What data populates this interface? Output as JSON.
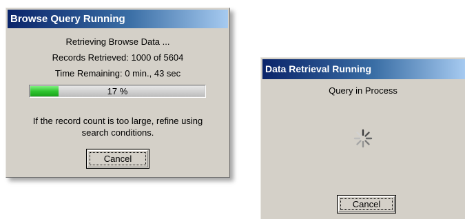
{
  "browse_dialog": {
    "title": "Browse Query Running",
    "status_line": "Retrieving Browse Data ...",
    "records_line": "Records Retrieved:  1000  of  5604",
    "time_line": "Time Remaining:  0 min., 43 sec",
    "progress": {
      "percent": 17,
      "label": "17 %"
    },
    "hint_line1": "If the record count is too large, refine using",
    "hint_line2": "search conditions.",
    "cancel_label": "Cancel"
  },
  "retrieval_dialog": {
    "title": "Data Retrieval Running",
    "status_line": "Query in Process",
    "spinner_icon": "busy-spinner-icon",
    "cancel_label": "Cancel"
  },
  "colors": {
    "title_bar_start": "#0a246a",
    "title_bar_end": "#a6caf0",
    "dialog_face": "#d4d0c8",
    "progress_fill": "#2fc52f"
  }
}
